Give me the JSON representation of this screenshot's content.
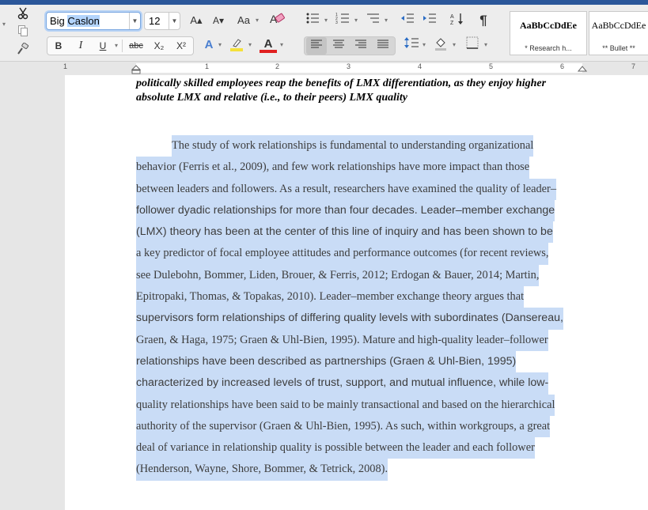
{
  "ribbon": {
    "font_name": {
      "before": "Big ",
      "selected": "Caslon"
    },
    "font_size": "12",
    "buttons": {
      "grow_font": "A▴",
      "shrink_font": "A▾",
      "change_case": "Aa",
      "bold": "B",
      "italic": "I",
      "underline": "U",
      "strikethrough": "abc",
      "subscript": "X₂",
      "superscript": "X²",
      "text_effects": "A",
      "font_color": "A"
    },
    "styles": [
      {
        "sample": "AaBbCcDdEe",
        "name": "* Research h..."
      },
      {
        "sample": "AaBbCcDdEe",
        "name": "** Bullet **"
      }
    ],
    "colors": {
      "highlight": "#f5e13a",
      "font_color": "#e02020",
      "selection": "#c9dcf6",
      "accent": "#2b579a"
    }
  },
  "ruler": {
    "numbers": [
      "1",
      "1",
      "2",
      "3",
      "4",
      "5",
      "6",
      "7"
    ]
  },
  "document": {
    "heading_lines": [
      "politically skilled employees reap the benefits of LMX differentiation, as they enjoy higher",
      "absolute LMX and relative (i.e., to their peers) LMX quality"
    ],
    "body_lines": [
      {
        "text": "The study of work relationships is fundamental to understanding organizational",
        "font": "serif",
        "indent": true
      },
      {
        "text": "behavior (Ferris et al., 2009), and few work relationships have more impact than those",
        "font": "serif"
      },
      {
        "text": "between leaders and followers. As a result, researchers have examined the quality of leader–",
        "font": "serif"
      },
      {
        "text": "follower dyadic relationships for more than four decades. Leader–member exchange",
        "font": "sans"
      },
      {
        "text": "(LMX) theory has been at the center of this line of inquiry and has been shown to be",
        "font": "sans"
      },
      {
        "text": "a key predictor of focal employee attitudes and performance outcomes (for recent reviews,",
        "font": "serif"
      },
      {
        "text": "see Dulebohn, Bommer, Liden, Brouer, & Ferris, 2012; Erdogan & Bauer, 2014; Martin,",
        "font": "serif"
      },
      {
        "text": "Epitropaki, Thomas, & Topakas, 2010). Leader–member exchange theory argues that",
        "font": "serif"
      },
      {
        "text": "supervisors form relationships of differing quality levels with subordinates (Dansereau,",
        "font": "sans"
      },
      {
        "text": "Graen, & Haga, 1975; Graen & Uhl-Bien, 1995). Mature and high-quality leader–follower",
        "font": "serif"
      },
      {
        "text": "relationships have been described as partnerships (Graen & Uhl-Bien, 1995)",
        "font": "sans"
      },
      {
        "text": "characterized by increased levels of trust, support, and mutual influence, while low-",
        "font": "sans"
      },
      {
        "text": "quality relationships have been said to be mainly transactional and based on the hierarchical",
        "font": "serif"
      },
      {
        "text": "authority of the supervisor (Graen & Uhl-Bien, 1995). As such, within workgroups, a great",
        "font": "serif"
      },
      {
        "text": "deal of variance in relationship quality is possible between the leader and each follower",
        "font": "serif"
      },
      {
        "text": "(Henderson, Wayne, Shore, Bommer, & Tetrick, 2008).",
        "font": "serif"
      }
    ]
  }
}
